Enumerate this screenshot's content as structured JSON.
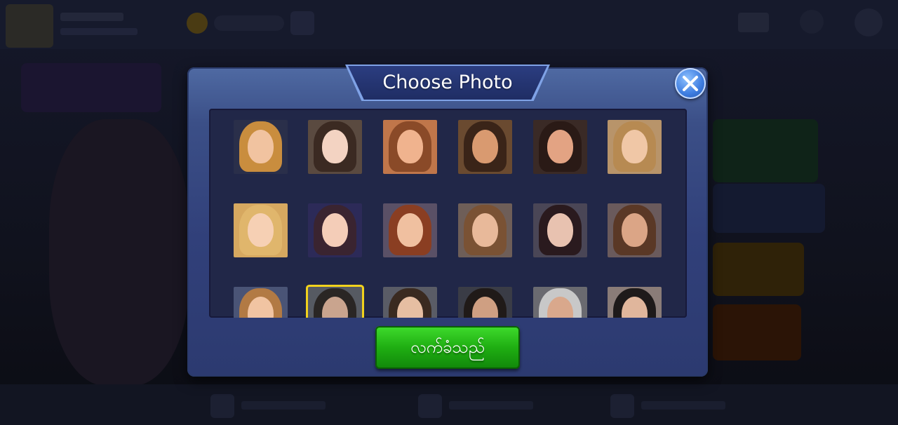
{
  "dialog": {
    "title": "Choose Photo",
    "accept_label": "လက်ခံသည်",
    "close_icon": "close-icon"
  },
  "colors": {
    "dialog_blue": "#3b4f87",
    "grid_panel": "#212748",
    "accept_green": "#1fae12",
    "selection_border": "#f2d21c",
    "close_blue": "#3e7de0"
  },
  "avatars": [
    {
      "name": "avatar-01",
      "hair": "#c98d3e",
      "skin": "#f1c3a0",
      "bg": "#2a2f4a",
      "selected": false
    },
    {
      "name": "avatar-02",
      "hair": "#3b2a22",
      "skin": "#f3d3c2",
      "bg": "#5a4a40",
      "selected": false
    },
    {
      "name": "avatar-03",
      "hair": "#8a4a28",
      "skin": "#f0b38e",
      "bg": "#c0764a",
      "selected": false
    },
    {
      "name": "avatar-04",
      "hair": "#3a2418",
      "skin": "#d99a70",
      "bg": "#6a4a30",
      "selected": false
    },
    {
      "name": "avatar-05",
      "hair": "#2a1a16",
      "skin": "#e3a383",
      "bg": "#3a2a26",
      "selected": false
    },
    {
      "name": "avatar-06",
      "hair": "#b78a52",
      "skin": "#f0c7a6",
      "bg": "#b8946a",
      "selected": false
    },
    {
      "name": "avatar-07",
      "hair": "#e0b66c",
      "skin": "#f6d0b4",
      "bg": "#d6a860",
      "selected": false
    },
    {
      "name": "avatar-08",
      "hair": "#3a2430",
      "skin": "#f4cdb8",
      "bg": "#2c2a58",
      "selected": false
    },
    {
      "name": "avatar-09",
      "hair": "#8a3e22",
      "skin": "#f0c0a0",
      "bg": "#5a5066",
      "selected": false
    },
    {
      "name": "avatar-10",
      "hair": "#7a5234",
      "skin": "#e8b99a",
      "bg": "#6e5e58",
      "selected": false
    },
    {
      "name": "avatar-11",
      "hair": "#2a1a1e",
      "skin": "#e8c2b0",
      "bg": "#4a4656",
      "selected": false
    },
    {
      "name": "avatar-12",
      "hair": "#5a3826",
      "skin": "#dba586",
      "bg": "#6a5a5c",
      "selected": false
    },
    {
      "name": "avatar-13",
      "hair": "#b27a44",
      "skin": "#f1c4a2",
      "bg": "#4a5476",
      "selected": false
    },
    {
      "name": "avatar-14",
      "hair": "#2a2624",
      "skin": "#c9a48e",
      "bg": "#565a62",
      "selected": true
    },
    {
      "name": "avatar-15",
      "hair": "#3a2a20",
      "skin": "#e6bea2",
      "bg": "#5a5c66",
      "selected": false
    },
    {
      "name": "avatar-16",
      "hair": "#201a18",
      "skin": "#cf9f82",
      "bg": "#3a3c46",
      "selected": false
    },
    {
      "name": "avatar-17",
      "hair": "#c8c8c8",
      "skin": "#d9a88c",
      "bg": "#6a6a70",
      "selected": false
    },
    {
      "name": "avatar-18",
      "hair": "#1e1a1a",
      "skin": "#e0b69c",
      "bg": "#8a7c78",
      "selected": false
    }
  ]
}
